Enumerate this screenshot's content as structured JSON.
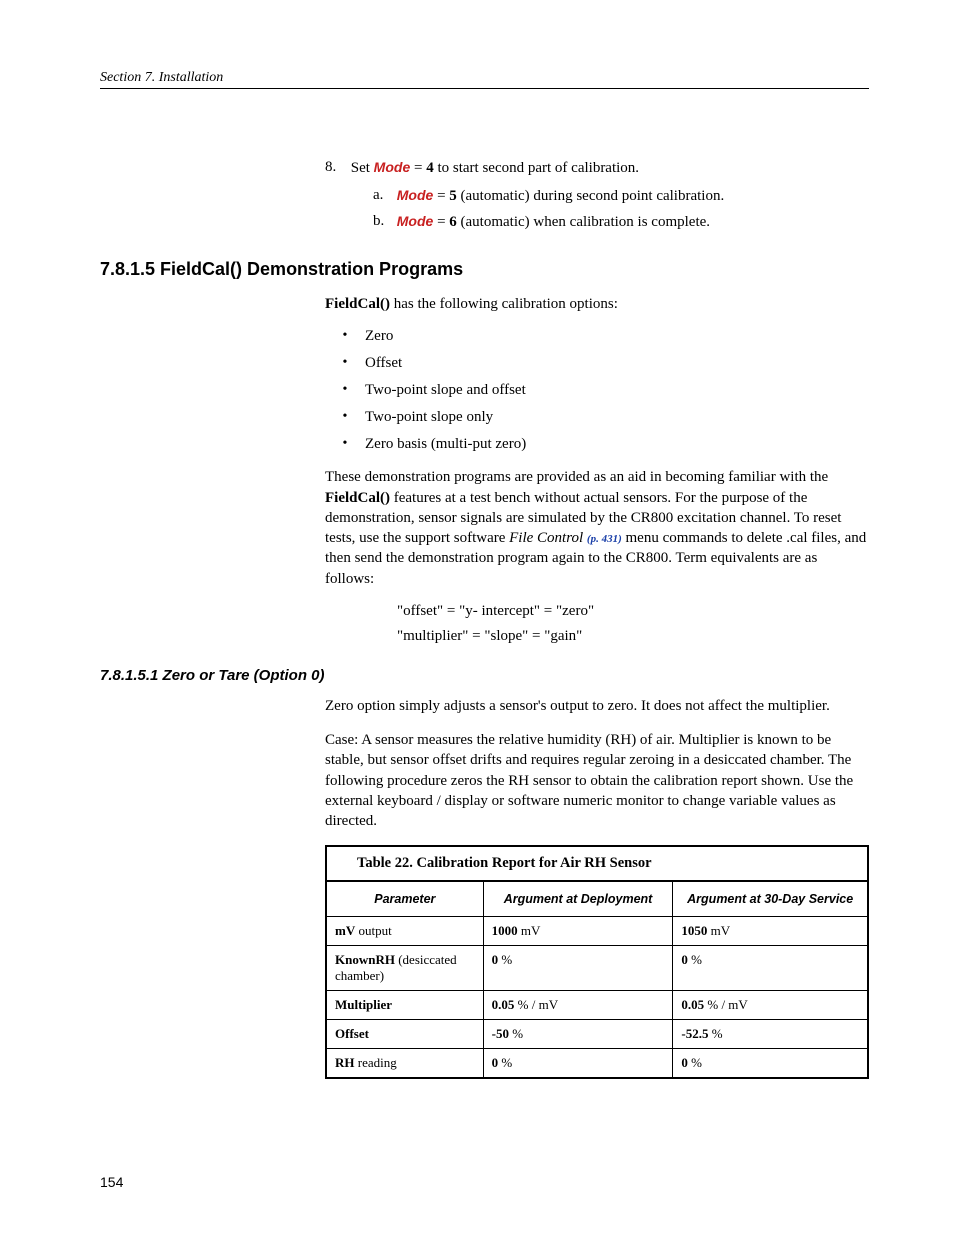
{
  "header": "Section 7.  Installation",
  "pageNumber": "154",
  "step8": {
    "num": "8.",
    "pre": "Set ",
    "kw": "Mode",
    "eq": " = ",
    "val": "4",
    "post": " to start second part of calibration."
  },
  "step8a": {
    "lbl": "a.",
    "kw": "Mode",
    "eq": " = ",
    "val": "5",
    "post": " (automatic) during second point calibration."
  },
  "step8b": {
    "lbl": "b.",
    "kw": "Mode",
    "eq": " = ",
    "val": "6",
    "post": " (automatic) when calibration is complete."
  },
  "h2": "7.8.1.5 FieldCal() Demonstration Programs",
  "introBold": "FieldCal()",
  "introRest": " has the following calibration options:",
  "bullets": [
    "Zero",
    "Offset",
    "Two-point slope and offset",
    "Two-point slope only",
    "Zero basis (multi-put zero)"
  ],
  "demoPara": {
    "p1": "These demonstration programs are provided as an aid in becoming familiar with the ",
    "b1": "FieldCal()",
    "p2": " features at a test bench without actual sensors. For the purpose of the demonstration, sensor signals are simulated by the CR800 excitation channel. To reset tests, use the support software ",
    "i1": "File Control ",
    "ref": "(p. 431)",
    "p3": " menu commands to delete .cal files, and then send the demonstration program again to the CR800. Term equivalents are as follows:"
  },
  "equiv1": "\"offset\" = \"y- intercept\" = \"zero\"",
  "equiv2": "\"multiplier\" = \"slope\" = \"gain\"",
  "h3": "7.8.1.5.1 Zero or Tare (Option 0)",
  "zeroPara1": "Zero option simply adjusts a sensor's output to zero.  It does not affect the multiplier.",
  "zeroPara2": "Case: A sensor measures the relative humidity (RH) of air.  Multiplier is known to be stable, but sensor offset drifts and requires regular zeroing in a desiccated chamber.  The following procedure zeros the RH sensor to obtain the calibration report shown. Use the external keyboard / display or software numeric monitor to change variable values as directed.",
  "table": {
    "caption": "Table 22. Calibration Report for Air RH Sensor",
    "headers": [
      "Parameter",
      "Argument at Deployment",
      "Argument at 30-Day Service"
    ],
    "rows": [
      {
        "pname": "mV",
        "pparen": " output",
        "v1b": "1000",
        "v1u": " mV",
        "v2b": "1050",
        "v2u": " mV"
      },
      {
        "pname": "KnownRH",
        "pparen": " (desiccated chamber)",
        "v1b": "0",
        "v1u": " %",
        "v2b": "0",
        "v2u": " %"
      },
      {
        "pname": "Multiplier",
        "pparen": "",
        "v1b": "0.05",
        "v1u": " % / mV",
        "v2b": "0.05",
        "v2u": " % / mV"
      },
      {
        "pname": "Offset",
        "pparen": "",
        "v1b": "-50",
        "v1u": " %",
        "v2b": "-52.5",
        "v2u": " %"
      },
      {
        "pname": "RH",
        "pparen": " reading",
        "v1b": "0",
        "v1u": " %",
        "v2b": "0",
        "v2u": " %"
      }
    ]
  }
}
